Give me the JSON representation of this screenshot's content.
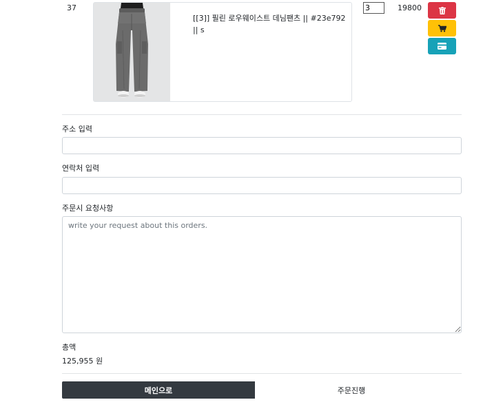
{
  "cart_item": {
    "index": "37",
    "product_name": "[[3]] 필린 로우웨이스트 데님팬츠 || #23e792 || s",
    "quantity": "3",
    "price": "19800",
    "photo": "gray-cargo-pants-photo"
  },
  "actions": {
    "delete_icon": "trash-icon",
    "cart_icon": "cart-icon",
    "pay_icon": "card-icon",
    "colors": {
      "delete": "#dc3545",
      "cart": "#ffc107",
      "pay": "#17a2b8"
    }
  },
  "form": {
    "address_label": "주소 입력",
    "address_value": "",
    "contact_label": "연락처 입력",
    "contact_value": "",
    "request_label": "주문시 요청사항",
    "request_placeholder": "write your request about this orders."
  },
  "summary": {
    "total_label": "총액",
    "total_value": "125,955 원"
  },
  "footer": {
    "main_button": "메인으로",
    "order_button": "주문진행",
    "main_color": "#343a40"
  }
}
